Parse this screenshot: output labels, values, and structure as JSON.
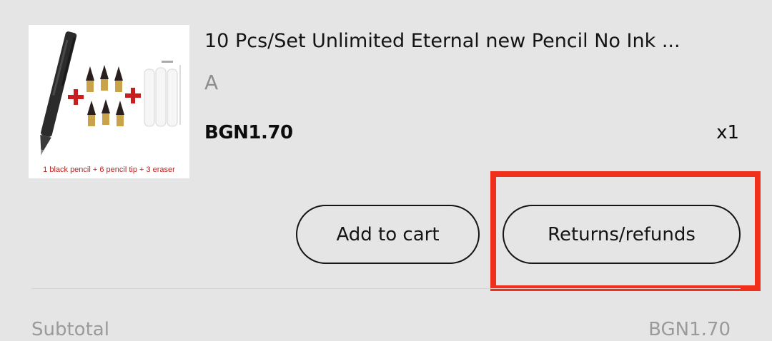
{
  "product": {
    "title": "10 Pcs/Set Unlimited Eternal new Pencil No Ink ...",
    "variant": "A",
    "price": "BGN1.70",
    "quantity": "x1",
    "image_caption": "1 black pencil + 6 pencil tip + 3 eraser",
    "image_icon": "product-thumbnail"
  },
  "actions": {
    "add_to_cart_label": "Add to cart",
    "returns_label": "Returns/refunds"
  },
  "summary": {
    "subtotal_label": "Subtotal",
    "subtotal_value": "BGN1.70"
  },
  "colors": {
    "background": "#e5e5e5",
    "highlight": "#f0301a",
    "caption": "#c0201e"
  }
}
